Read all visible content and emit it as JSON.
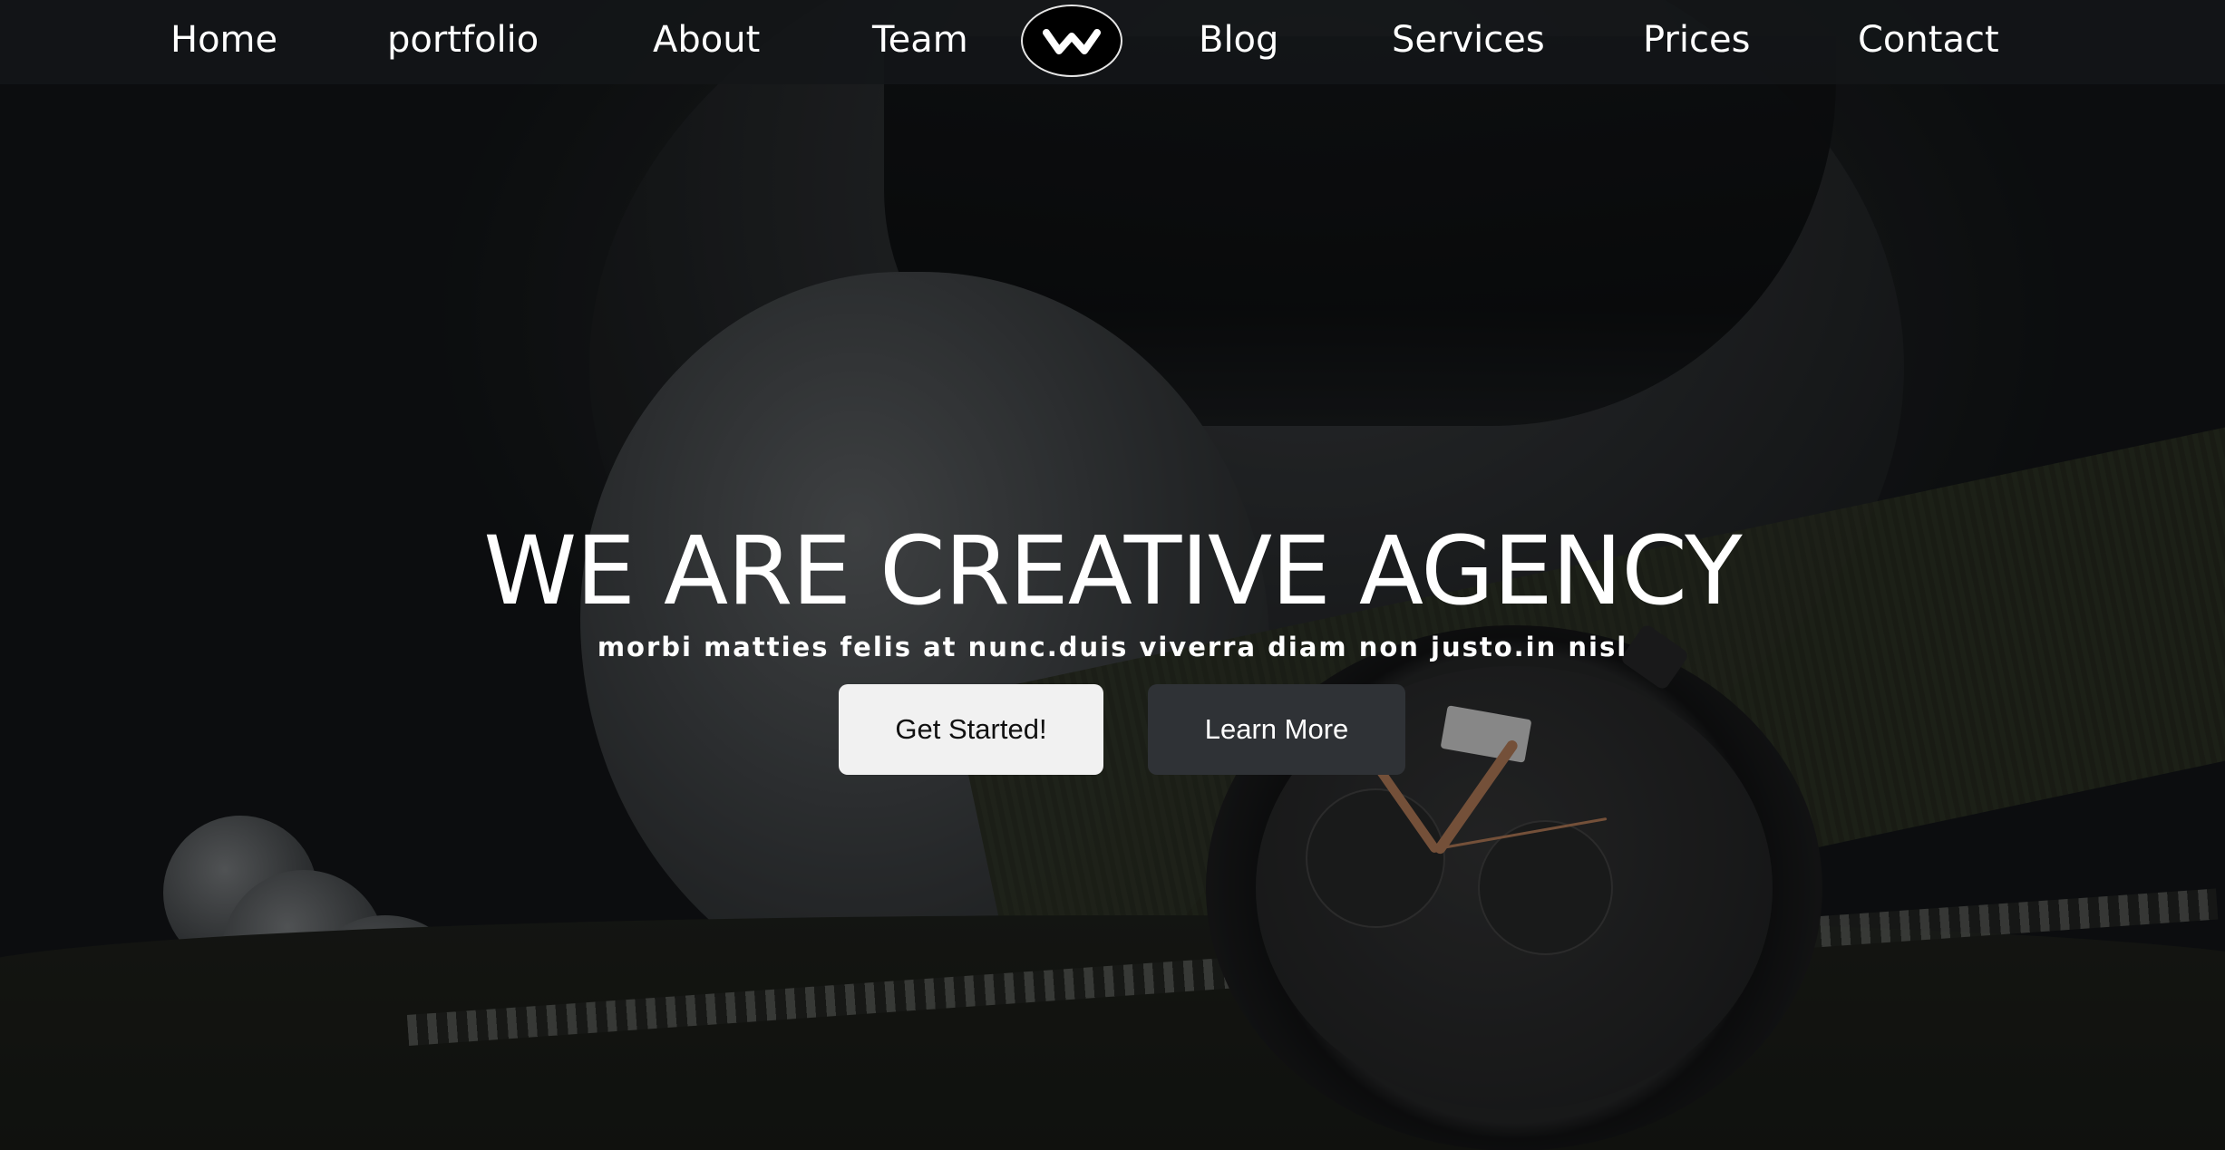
{
  "nav": {
    "items": [
      {
        "label": "Home"
      },
      {
        "label": "portfolio"
      },
      {
        "label": "About"
      },
      {
        "label": "Team"
      },
      {
        "label": "Blog"
      },
      {
        "label": "Services"
      },
      {
        "label": "Prices"
      },
      {
        "label": "Contact"
      }
    ],
    "logo_icon": "w-logo-icon"
  },
  "hero": {
    "headline": "WE ARE CREATIVE AGENCY",
    "subline": "morbi matties felis at nunc.duis viverra diam non justo.in nisl",
    "primary_button": "Get Started!",
    "secondary_button": "Learn More",
    "background": "dark photo of pilot helmet, oxygen mask and chronograph wristwatch"
  },
  "colors": {
    "nav_bg": "#141618",
    "text": "#ffffff",
    "primary_button_bg": "#f1f1f1",
    "secondary_button_bg": "#2f3236"
  }
}
